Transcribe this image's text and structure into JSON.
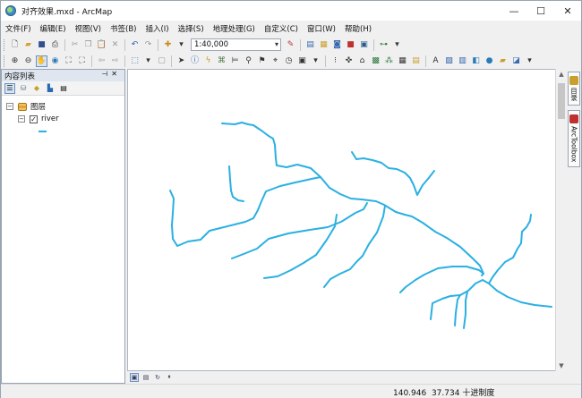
{
  "window": {
    "title": "对齐效果.mxd - ArcMap"
  },
  "menu": [
    "文件(F)",
    "编辑(E)",
    "视图(V)",
    "书签(B)",
    "插入(I)",
    "选择(S)",
    "地理处理(G)",
    "自定义(C)",
    "窗口(W)",
    "帮助(H)"
  ],
  "toolbar": {
    "scale": "1:40,000"
  },
  "toc": {
    "title": "内容列表",
    "root_layer": "图层",
    "layer_name": "river"
  },
  "side_tabs": {
    "catalog": "目录",
    "toolbox": "ArcToolbox"
  },
  "status": {
    "x": "140.946",
    "y": "37.734",
    "unit": "十进制度"
  },
  "colors": {
    "river": "#2ab0e2",
    "panel_header": "#dfe6ef"
  }
}
